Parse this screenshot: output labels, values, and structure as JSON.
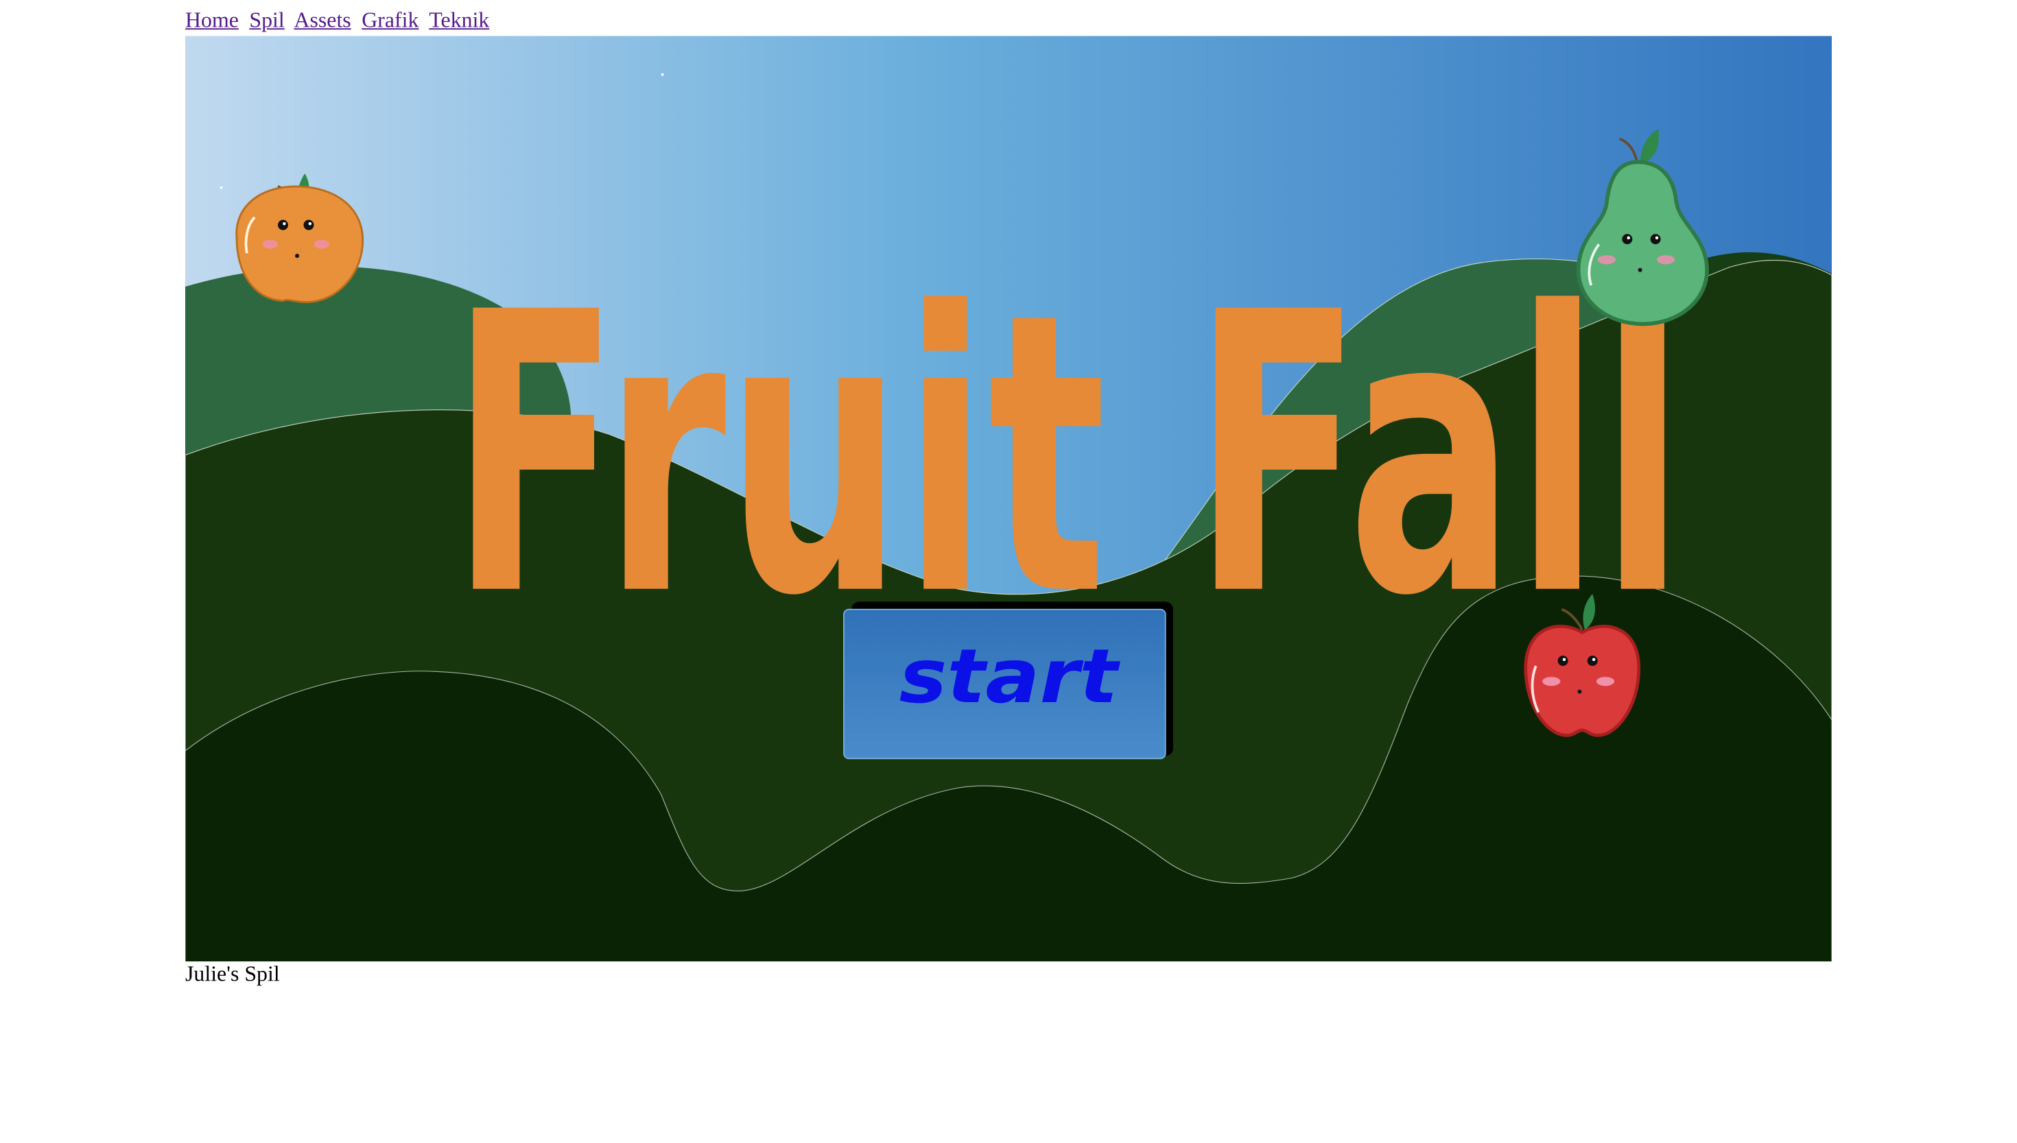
{
  "nav": {
    "links": [
      {
        "label": "Home"
      },
      {
        "label": "Spil"
      },
      {
        "label": "Assets"
      },
      {
        "label": "Grafik"
      },
      {
        "label": "Teknik"
      }
    ]
  },
  "game": {
    "title": "Fruit Fall",
    "start_label": "start",
    "fruits": [
      "orange",
      "pear",
      "apple"
    ],
    "colors": {
      "sky_light": "#c0d9ef",
      "sky_dark": "#3375bf",
      "title": "#e68a38",
      "hill_back": "#2d6840",
      "hill_mid": "#17360d",
      "hill_front": "#0b2305",
      "button": "#3d7dc1",
      "button_text": "#0a10e6"
    }
  },
  "footer": {
    "text": "Julie's Spil"
  }
}
